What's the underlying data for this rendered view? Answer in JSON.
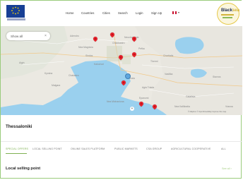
{
  "header": {
    "nav": [
      "Home",
      "Countries",
      "Cities",
      "Search",
      "Login",
      "Sign Up"
    ],
    "brand": "Black",
    "brand_suffix": "sea"
  },
  "map": {
    "search_value": "Show all",
    "search_clear": "×",
    "zoom_in": "+",
    "attribution": "© Mapbox © OpenStreetMap Improve this map",
    "labels": [
      "Adendro",
      "Sindos",
      "Kalochori",
      "Nea Magnisia",
      "Neochorouda",
      "Oraiokastro",
      "Pefka",
      "Thermi",
      "Vasilika",
      "Agia Triada",
      "Peraia",
      "Epanomi",
      "Nea Michaniona",
      "Aigin",
      "Kymina",
      "Malgara",
      "Chalastra",
      "Stavros",
      "Nea Kallikratia",
      "Galatista",
      "Vrasna",
      "Chortiatis"
    ]
  },
  "page": {
    "city_title": "Thessaloniki",
    "tabs": [
      "SPECIAL OFFERS",
      "LOCAL SELLING POINT",
      "ONLINE SALES PLATFORM",
      "PUBLIC MARKETS",
      "CSA GROUP",
      "AGRICULTURAL COOPERATIVE",
      "ALL"
    ],
    "section_title": "Local selling point",
    "see_all": "See all ›"
  },
  "colors": {
    "accent_green": "#7fb153",
    "pin_red": "#e8202a",
    "water_blue": "#9ad0ee"
  }
}
